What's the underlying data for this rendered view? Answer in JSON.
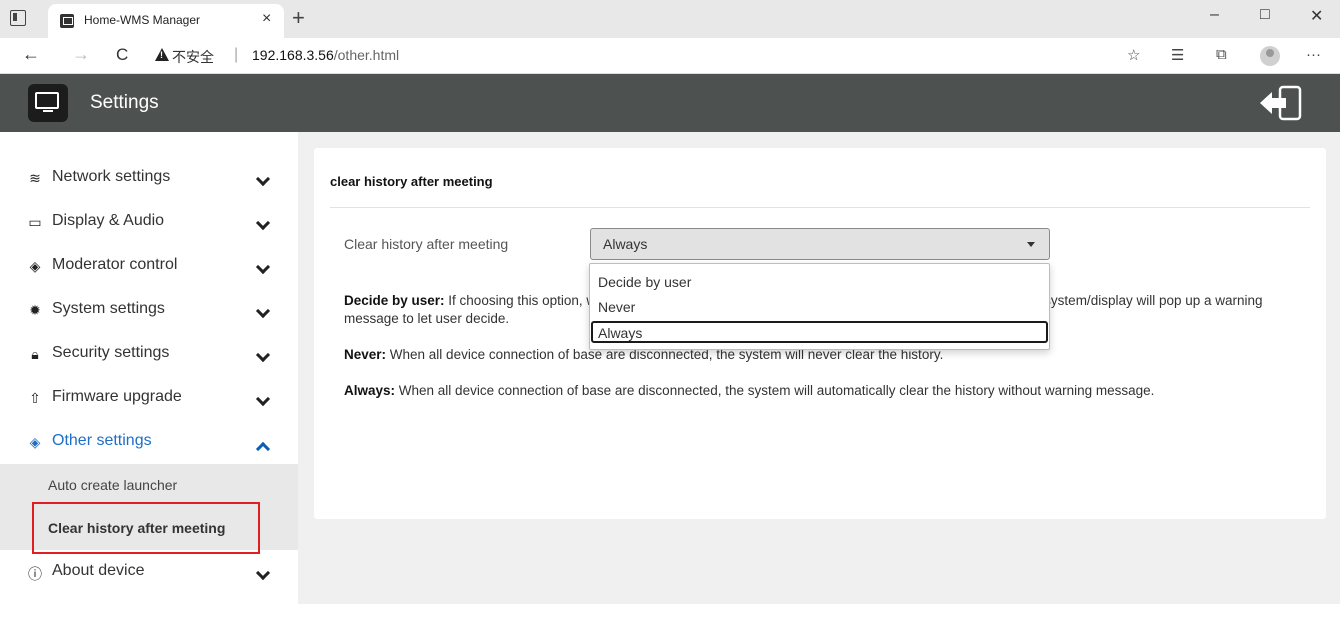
{
  "browser": {
    "tab_title": "Home-WMS Manager",
    "tab_close": "×",
    "new_tab": "+",
    "window_controls": [
      "–",
      "□",
      "✕"
    ],
    "back": "←",
    "forward": "→",
    "reload": "C",
    "insecure_label": "不安全",
    "separator": "|",
    "url_host": "192.168.3.56",
    "url_path": "/other.html",
    "more": "···"
  },
  "header": {
    "title": "Settings"
  },
  "sidebar": {
    "items": [
      {
        "label": "Network settings",
        "icon": "wifi-icon"
      },
      {
        "label": "Display & Audio",
        "icon": "monitor-icon"
      },
      {
        "label": "Moderator control",
        "icon": "gem-icon"
      },
      {
        "label": "System settings",
        "icon": "gear-icon"
      },
      {
        "label": "Security settings",
        "icon": "lock-icon"
      },
      {
        "label": "Firmware upgrade",
        "icon": "upload-icon"
      },
      {
        "label": "Other settings",
        "icon": "gem-icon"
      },
      {
        "label": "About device",
        "icon": "info-icon"
      }
    ],
    "submenu": [
      "Auto create launcher",
      "Clear history after meeting"
    ]
  },
  "content": {
    "section_title": "clear history after meeting",
    "field_label": "Clear history after meeting",
    "selected_value": "Always",
    "options": [
      "Decide by user",
      "Never",
      "Always"
    ],
    "desc1_bold": "Decide by user:",
    "desc1_text": " If choosing this option, when all device connection of base and dongle are disconnected from base, system/display will pop up a warning message to let user decide.",
    "desc2_bold": "Never:",
    "desc2_text": " When all device connection of base are disconnected, the system will never clear the history.",
    "desc3_bold": "Always:",
    "desc3_text": " When all device connection of base are disconnected, the system will automatically clear the history without warning message."
  },
  "colors": {
    "header_bg": "#4d5150",
    "active_blue": "#1e6ec8",
    "highlight_red": "#e02020"
  }
}
